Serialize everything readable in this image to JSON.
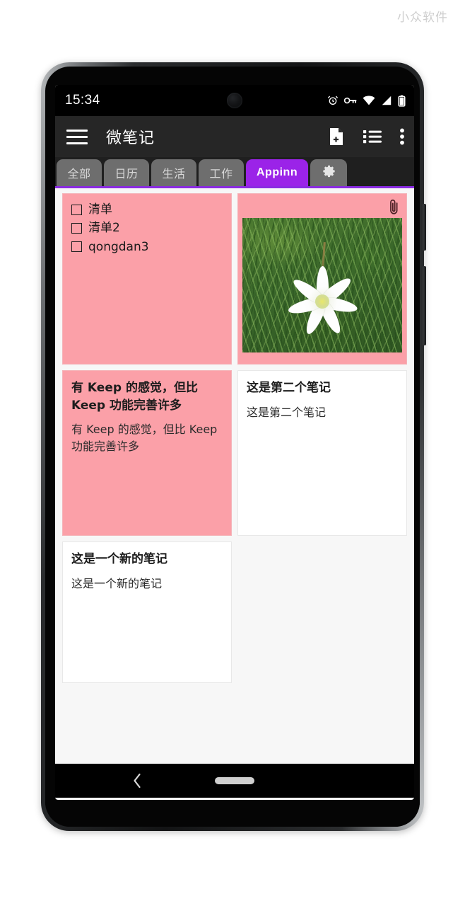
{
  "watermark": "小众软件",
  "status_bar": {
    "time": "15:34",
    "icons": [
      "alarm-icon",
      "vpn-key-icon",
      "wifi-icon",
      "cellular-signal-icon",
      "battery-icon"
    ]
  },
  "app_bar": {
    "menu_icon": "hamburger-menu-icon",
    "title": "微笔记",
    "actions": [
      {
        "name": "new-note-icon",
        "label": "新建笔记"
      },
      {
        "name": "list-view-icon",
        "label": "列表视图"
      },
      {
        "name": "overflow-menu-icon",
        "label": "更多"
      }
    ]
  },
  "tabs": {
    "active_index": 4,
    "items": [
      {
        "label": "全部",
        "active": false
      },
      {
        "label": "日历",
        "active": false
      },
      {
        "label": "生活",
        "active": false
      },
      {
        "label": "工作",
        "active": false
      },
      {
        "label": "Appinn",
        "active": true
      }
    ],
    "settings_tab": {
      "icon": "gear-icon",
      "label": ""
    }
  },
  "notes": [
    {
      "id": "note-checklist",
      "type": "checklist",
      "color": "pink",
      "items": [
        {
          "text": "清单",
          "checked": false
        },
        {
          "text": "清单2",
          "checked": false
        },
        {
          "text": "qongdan3",
          "checked": false
        }
      ]
    },
    {
      "id": "note-attachment",
      "type": "attachment",
      "color": "pink",
      "attachment_icon": "paperclip-icon",
      "image_alt": "白色花朵与草地照片"
    },
    {
      "id": "note-keep",
      "type": "text",
      "color": "pink",
      "title": "有 Keep 的感觉，但比 Keep 功能完善许多",
      "body": "有 Keep 的感觉，但比 Keep 功能完善许多"
    },
    {
      "id": "note-second",
      "type": "text",
      "color": "white",
      "title": "这是第二个笔记",
      "body": "这是第二个笔记"
    },
    {
      "id": "note-new",
      "type": "text",
      "color": "white",
      "title": "这是一个新的笔记",
      "body": "这是一个新的笔记"
    }
  ],
  "nav_bar": {
    "back_icon": "back-chevron-icon",
    "home_indicator": "home-pill-indicator"
  },
  "colors": {
    "accent_purple": "#9b23e8",
    "note_pink": "#fba0a8",
    "app_bar": "#262626",
    "tab_inactive": "#6e6e6e",
    "background": "#f7f7f7"
  }
}
